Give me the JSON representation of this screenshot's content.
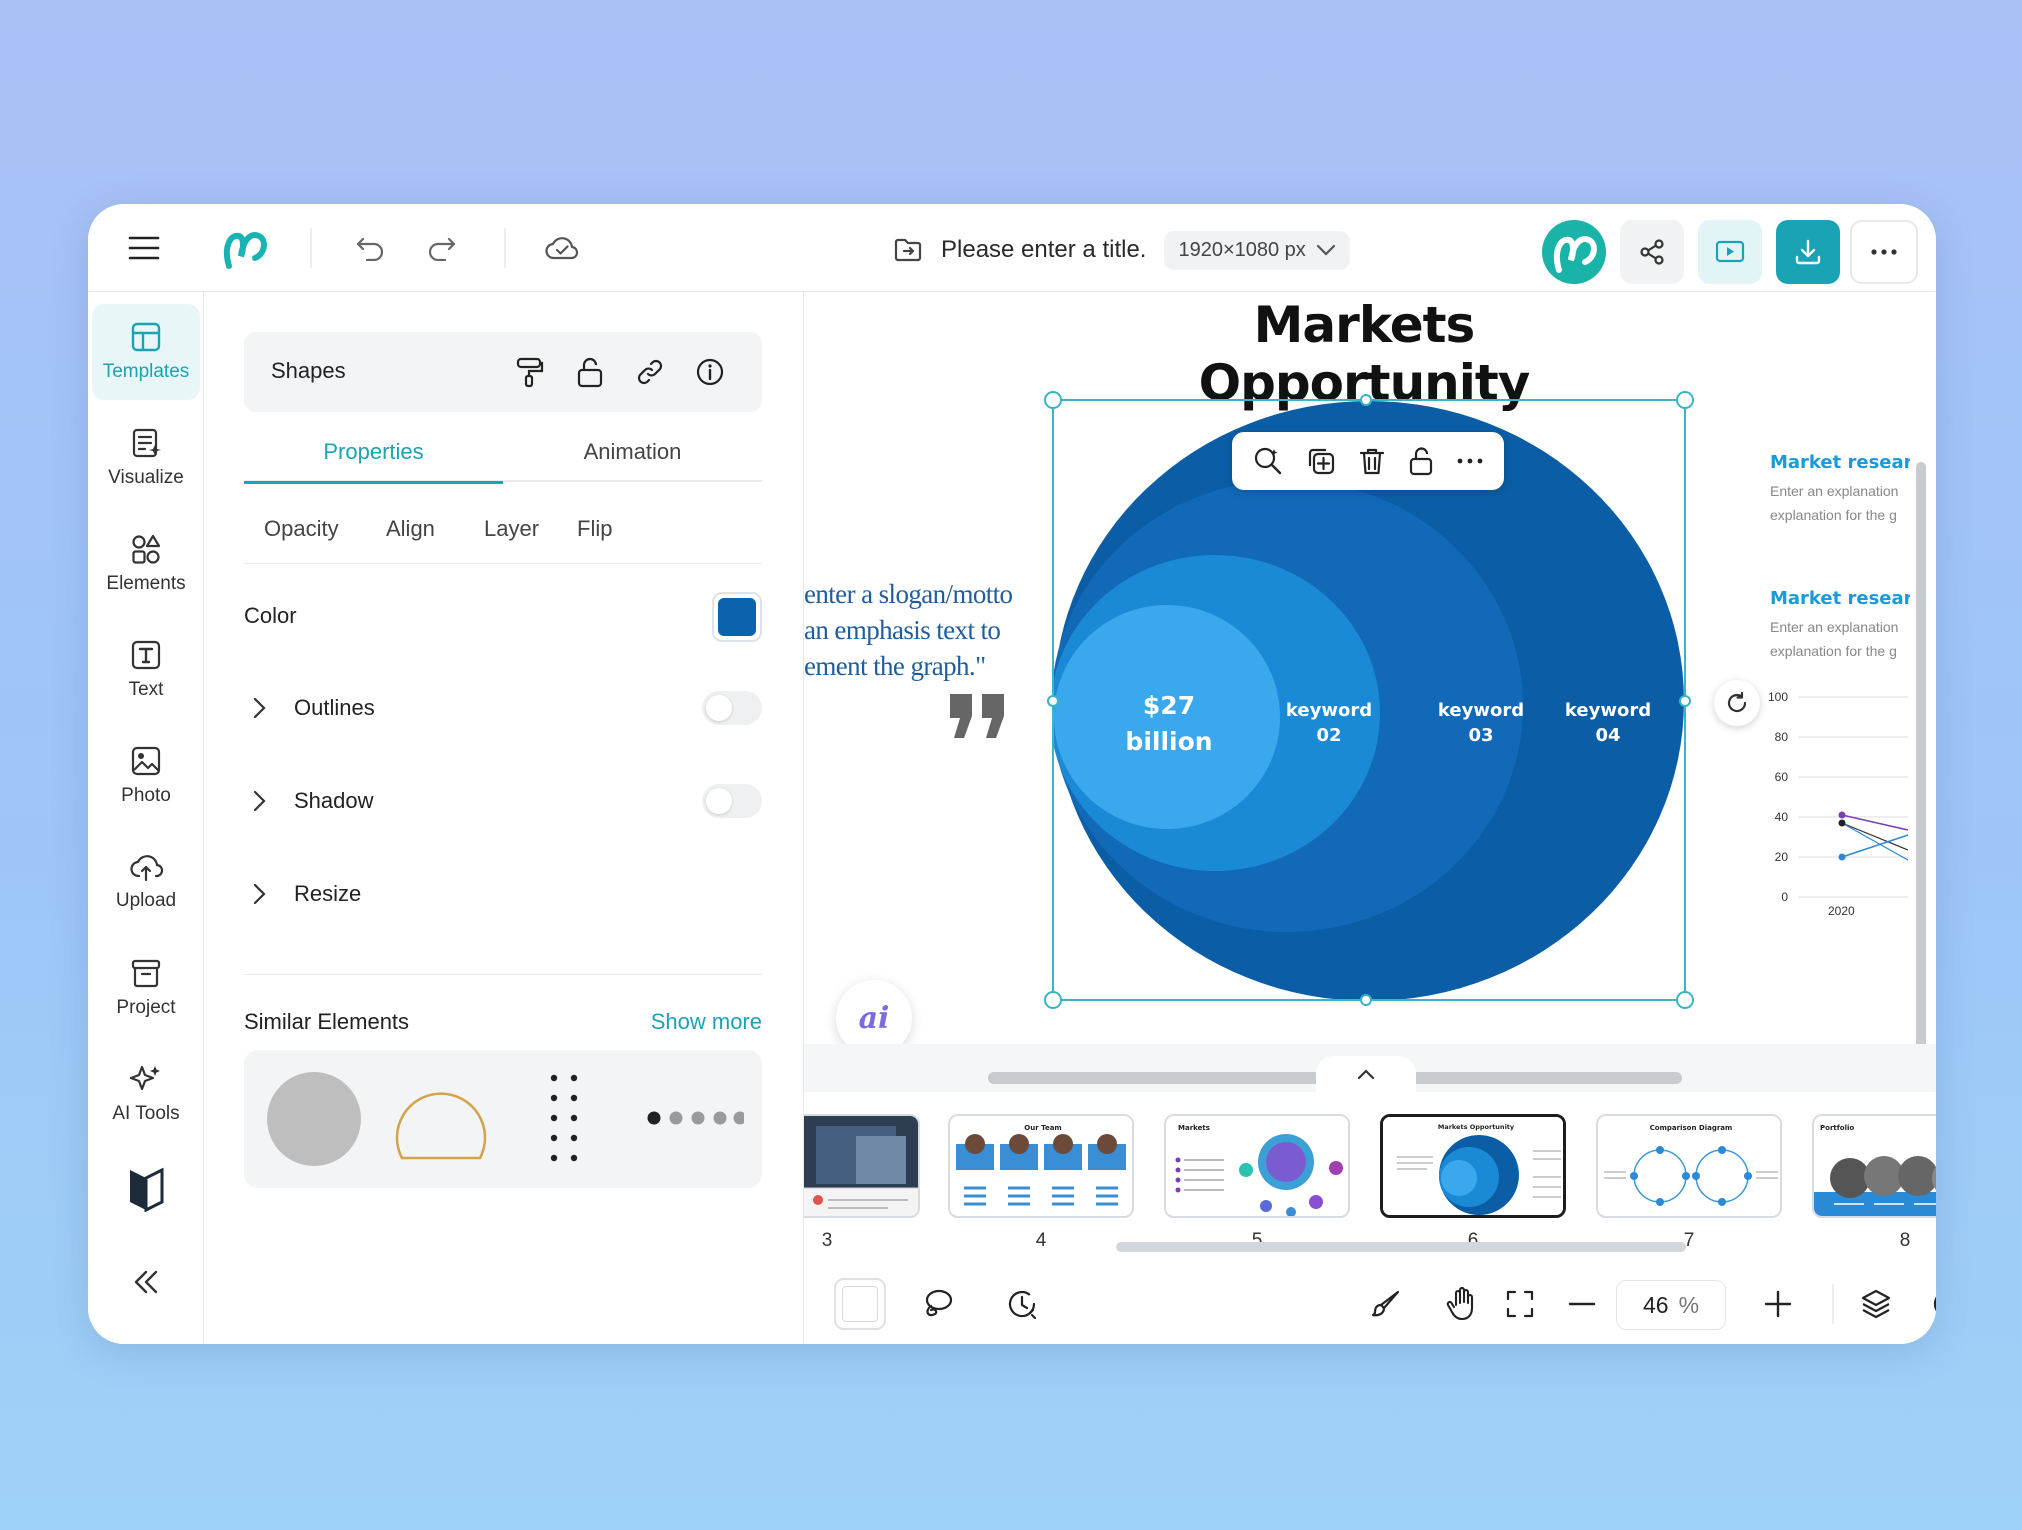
{
  "app": {
    "logo_label": "Mango"
  },
  "header": {
    "doc_title": "Please enter a title.",
    "canvas_size": "1920×1080 px"
  },
  "nav": {
    "items": [
      {
        "label": "Templates",
        "icon": "template-icon"
      },
      {
        "label": "Visualize",
        "icon": "visualize-icon"
      },
      {
        "label": "Elements",
        "icon": "elements-icon"
      },
      {
        "label": "Text",
        "icon": "text-icon"
      },
      {
        "label": "Photo",
        "icon": "photo-icon"
      },
      {
        "label": "Upload",
        "icon": "upload-icon"
      },
      {
        "label": "Project",
        "icon": "project-icon"
      },
      {
        "label": "AI Tools",
        "icon": "ai-tools-icon"
      }
    ],
    "active": "Templates"
  },
  "panel": {
    "section_title": "Shapes",
    "tabs": [
      "Properties",
      "Animation"
    ],
    "active_tab": "Properties",
    "subtabs": [
      "Opacity",
      "Align",
      "Layer",
      "Flip"
    ],
    "color_label": "Color",
    "color_value": "#0b63ad",
    "rows": [
      {
        "label": "Outlines",
        "toggle": false
      },
      {
        "label": "Shadow",
        "toggle": false
      },
      {
        "label": "Resize"
      }
    ],
    "similar_title": "Similar Elements",
    "show_more": "Show more"
  },
  "slide": {
    "title": "Markets Opportunity",
    "quote_lines": [
      "enter a slogan/motto",
      "an emphasis text to",
      "ement the graph.\""
    ],
    "center_value_line1": "$27",
    "center_value_line2": "billion",
    "keywords": [
      {
        "line1": "keyword",
        "line2": "02"
      },
      {
        "line1": "keyword",
        "line2": "03"
      },
      {
        "line1": "keyword",
        "line2": "04"
      }
    ],
    "side_blocks": [
      {
        "title": "Market researc",
        "line1": "Enter an explanation",
        "line2": "explanation for the g"
      },
      {
        "title": "Market researc",
        "line1": "Enter an explanation",
        "line2": "explanation for the g"
      }
    ],
    "mini_chart_ticks": [
      "100",
      "80",
      "60",
      "40",
      "20",
      "0"
    ],
    "mini_chart_x": "2020",
    "ai_badge": "ai"
  },
  "colors": {
    "accent": "#1aa3b5",
    "ring_outer": "#0b5ea6",
    "ring_2": "#1269b8",
    "ring_3": "#1b8ad6",
    "ring_inner": "#3aa8ec"
  },
  "filmstrip": {
    "slides": [
      {
        "num": "3",
        "title": ""
      },
      {
        "num": "4",
        "title": "Our Team"
      },
      {
        "num": "5",
        "title": "Markets"
      },
      {
        "num": "6",
        "title": "Markets Opportunity"
      },
      {
        "num": "7",
        "title": "Comparison Diagram"
      },
      {
        "num": "8",
        "title": "Portfolio"
      }
    ],
    "active": "6"
  },
  "bottom": {
    "zoom_value": "46",
    "zoom_unit": "%"
  }
}
